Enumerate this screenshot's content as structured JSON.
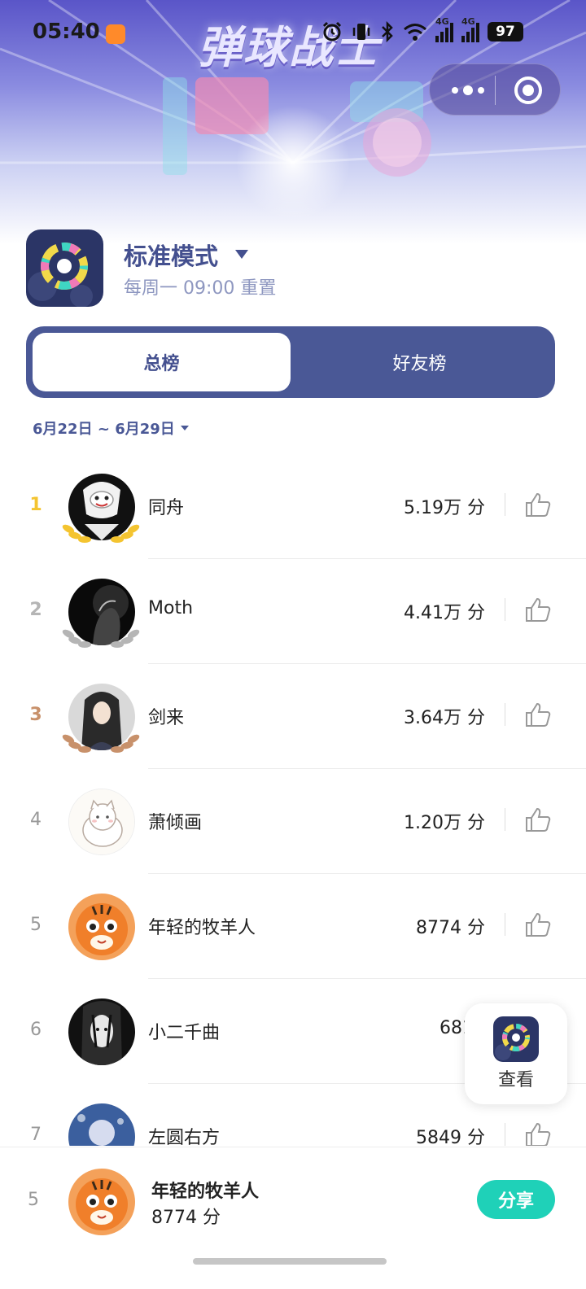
{
  "status_bar": {
    "time": "05:40",
    "network_1": "4G",
    "network_2": "4G",
    "battery": "97",
    "icons": [
      "alarm-icon",
      "vibrate-icon",
      "bluetooth-icon",
      "wifi-icon",
      "signal-icon",
      "signal-icon"
    ]
  },
  "hero": {
    "title": "弹球战士"
  },
  "capsule": {
    "more_icon": "more-dots-icon",
    "close_icon": "target-icon"
  },
  "mode": {
    "title": "标准模式",
    "subtitle": "每周一 09:00 重置"
  },
  "tabs": [
    {
      "label": "总榜",
      "active": true
    },
    {
      "label": "好友榜",
      "active": false
    }
  ],
  "date_range": {
    "label": "6月22日 ~ 6月29日"
  },
  "leaderboard": [
    {
      "rank": "1",
      "name": "同舟",
      "score": "5.19万 分"
    },
    {
      "rank": "2",
      "name": "Moth",
      "score": "4.41万 分"
    },
    {
      "rank": "3",
      "name": "剑来",
      "score": "3.64万 分"
    },
    {
      "rank": "4",
      "name": "萧倾画",
      "score": "1.20万 分"
    },
    {
      "rank": "5",
      "name": "年轻的牧羊人",
      "score": "8774 分"
    },
    {
      "rank": "6",
      "name": "小二千曲",
      "score": "6813"
    },
    {
      "rank": "7",
      "name": "左圆右方",
      "score": "5849 分"
    }
  ],
  "float_button": {
    "label": "查看"
  },
  "my_rank": {
    "rank": "5",
    "name": "年轻的牧羊人",
    "score": "8774 分",
    "share_label": "分享"
  },
  "colors": {
    "accent": "#4a5896",
    "share": "#1fd1b8",
    "gold": "#f4c430",
    "silver": "#b5b5b5",
    "bronze": "#c8916b"
  }
}
